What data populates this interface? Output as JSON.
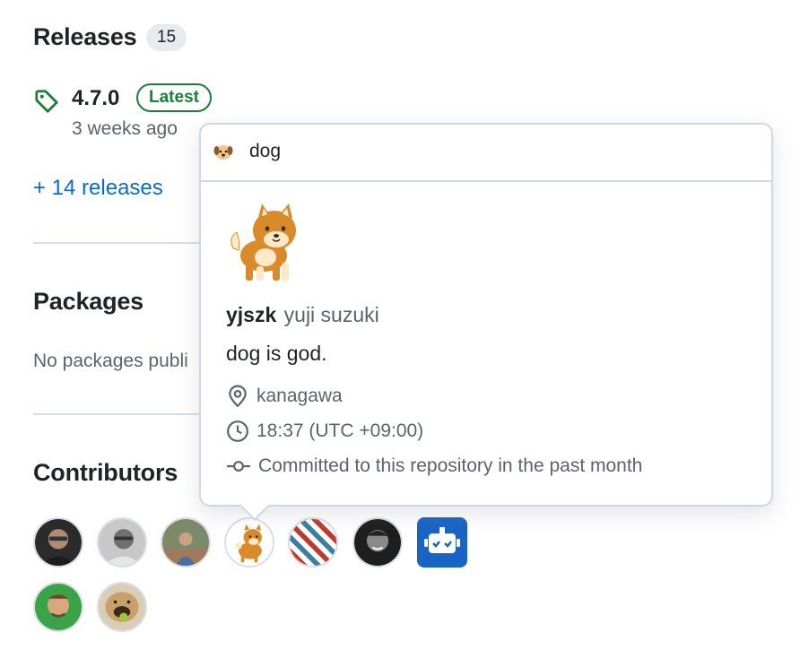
{
  "releases": {
    "title": "Releases",
    "count": "15",
    "latest": {
      "version": "4.7.0",
      "badge": "Latest",
      "time": "3 weeks ago"
    },
    "more_link": "+ 14 releases"
  },
  "packages": {
    "title": "Packages",
    "empty_text": "No packages publi"
  },
  "contributors": {
    "title": "Contributors",
    "avatars": [
      "contributor-1",
      "contributor-2",
      "contributor-3",
      "yjszk",
      "contributor-5",
      "contributor-6",
      "bot",
      "contributor-8",
      "contributor-9"
    ]
  },
  "popover": {
    "header_label": "dog",
    "login": "yjszk",
    "full_name": "yuji suzuki",
    "bio": "dog is god.",
    "location": "kanagawa",
    "local_time": "18:37 (UTC +09:00)",
    "activity": "Committed to this repository in the past month"
  },
  "colors": {
    "link": "#0969da",
    "latest_green": "#1a7f37",
    "muted": "#59636e",
    "border": "#d0d7de"
  }
}
